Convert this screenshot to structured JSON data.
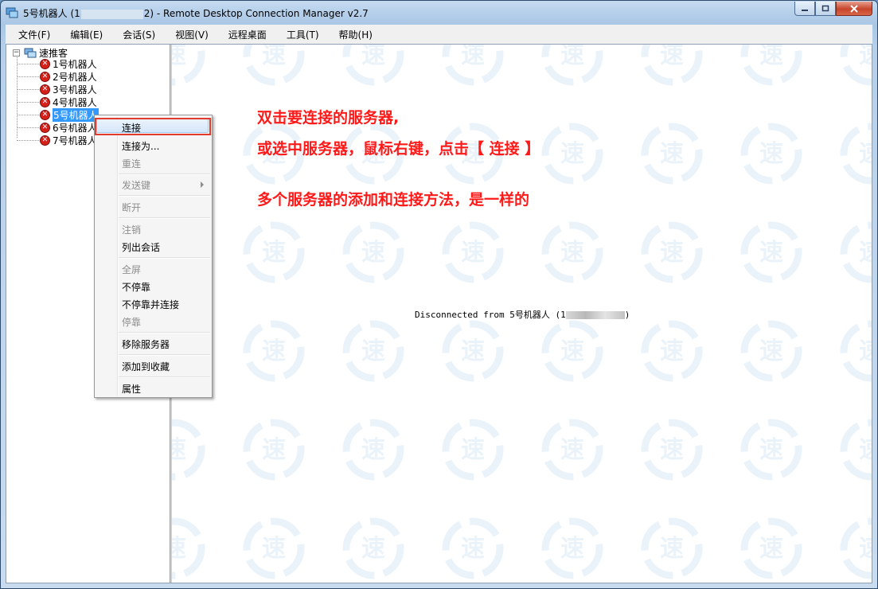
{
  "window": {
    "title_prefix": "5号机器人 (1",
    "title_suffix": "2) - Remote Desktop Connection Manager v2.7",
    "controls": {
      "minimize_icon": "minimize-icon",
      "maximize_icon": "maximize-icon",
      "close_icon": "close-icon"
    }
  },
  "menubar": [
    "文件(F)",
    "编辑(E)",
    "会话(S)",
    "视图(V)",
    "远程桌面",
    "工具(T)",
    "帮助(H)"
  ],
  "tree": {
    "root": "速推客",
    "nodes": [
      "1号机器人",
      "2号机器人",
      "3号机器人",
      "4号机器人",
      "5号机器人",
      "6号机器人",
      "7号机器人"
    ],
    "selected_index": 4,
    "node_icon": "disconnected-x-icon"
  },
  "context_menu": {
    "items": [
      {
        "label": "连接",
        "enabled": true,
        "highlighted": true
      },
      {
        "label": "连接为...",
        "enabled": true
      },
      {
        "label": "重连",
        "enabled": false
      },
      {
        "label": "发送键",
        "enabled": false,
        "submenu": true
      },
      {
        "label": "断开",
        "enabled": false
      },
      {
        "label": "注销",
        "enabled": false
      },
      {
        "label": "列出会话",
        "enabled": true
      },
      {
        "label": "全屏",
        "enabled": false
      },
      {
        "label": "不停靠",
        "enabled": true
      },
      {
        "label": "不停靠并连接",
        "enabled": true
      },
      {
        "label": "停靠",
        "enabled": false
      },
      {
        "label": "移除服务器",
        "enabled": true
      },
      {
        "label": "添加到收藏",
        "enabled": true
      },
      {
        "label": "属性",
        "enabled": true
      }
    ]
  },
  "annotation": {
    "line1": "双击要连接的服务器,",
    "line2": "或选中服务器，鼠标右键，点击【 连接 】",
    "line3": "多个服务器的添加和连接方法，是一样的",
    "color": "#ff1a1a"
  },
  "status": {
    "disconnected_prefix": "Disconnected from 5号机器人 (1",
    "disconnected_suffix": ")"
  },
  "watermark": {
    "glyph": "速",
    "color": "#2a7fd4"
  }
}
